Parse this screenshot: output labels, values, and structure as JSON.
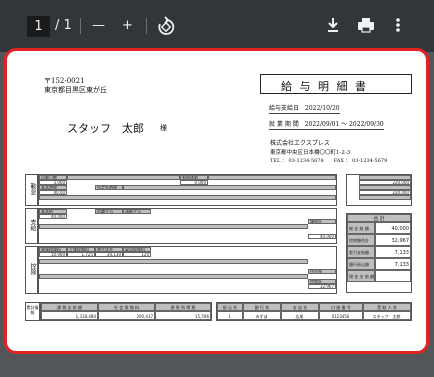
{
  "toolbar": {
    "page_current": "1",
    "page_total": "/ 1",
    "zoom_out": "—",
    "zoom_in": "+"
  },
  "doc": {
    "postal": "〒152-0021",
    "address": "東京都目黒区東が丘",
    "recipient": "スタッフ　太郎",
    "honorific": "様",
    "title": "給 与 明 細 書",
    "pay_date": "給与支給日　2022/10/20",
    "period": "就 業 期 間　2022/09/01 ～ 2022/09/30",
    "company": "株式会社エクスプレス",
    "company_addr": "東京都中央区日本橋〇〇町1-2-3",
    "tel_fax": "TEL ： 03-1234-5678　　FAX ： 03-1234-5679",
    "section_labels": [
      "勤怠",
      "支給",
      "控除"
    ],
    "kintai_cells": [
      "出勤日数",
      "3.000",
      "有給休暇",
      "0.000",
      "基本時間",
      "40.00",
      "所定外時間"
    ],
    "shikyu_cells": [
      "基本給",
      "40,000",
      "役職手当",
      "通勤手当",
      "課税計",
      "40,000"
    ],
    "kojo_cells": [
      "健康保険料",
      "10,900",
      "介護保険料",
      "1,725",
      "厚生年金",
      "20,130",
      "雇用保険料",
      "120",
      "住民税",
      "控除計",
      "32,967"
    ],
    "right_summary": {
      "header": "合 計",
      "rows": [
        {
          "label": "総 支 給 額",
          "value": "40,000"
        },
        {
          "label": "控除額合計",
          "value": "32,967"
        },
        {
          "label": "差引支給額",
          "value": "7,133"
        },
        {
          "label": "銀行振込額",
          "value": "7,133"
        },
        {
          "label": "現 金 支 給 額",
          "value": ""
        }
      ],
      "top_values": [
        "220,000",
        "220,000"
      ]
    },
    "bottom": {
      "label": "累計情報",
      "headers": [
        "課 税 支 給 額",
        "社 会 保 険 料",
        "源 泉 所 得 税"
      ],
      "values": [
        "1,318,480",
        "200,437",
        "15,596"
      ],
      "bank_headers": [
        "振 込 先",
        "銀 行 名",
        "支 店 名",
        "口 座 番 号",
        "受 取 人 名"
      ],
      "bank_values": [
        "1",
        "みずほ",
        "広尾",
        "0123456",
        "スタッフ　太郎"
      ]
    }
  }
}
